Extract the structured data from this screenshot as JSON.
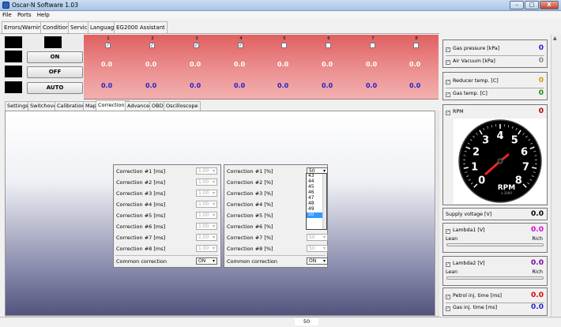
{
  "window": {
    "title": "Oscar-N Software 1.03",
    "minimize": "–",
    "maximize": "□",
    "close": "X"
  },
  "menu": [
    "File",
    "Ports",
    "Help"
  ],
  "top_tabs": [
    "Errors/Warnings",
    "Conditions",
    "Service",
    "Language",
    "EG2000 Assistant"
  ],
  "control_buttons": [
    "ON",
    "OFF",
    "AUTO"
  ],
  "channels": [
    {
      "num": "1",
      "white": "0.0",
      "blue": "0.0",
      "checked": true
    },
    {
      "num": "2",
      "white": "0.0",
      "blue": "0.0",
      "checked": true
    },
    {
      "num": "3",
      "white": "0.0",
      "blue": "0.0",
      "checked": true
    },
    {
      "num": "4",
      "white": "0.0",
      "blue": "0.0",
      "checked": true
    },
    {
      "num": "5",
      "white": "0.0",
      "blue": "0.0",
      "checked": false
    },
    {
      "num": "6",
      "white": "0.0",
      "blue": "0.0",
      "checked": false
    },
    {
      "num": "7",
      "white": "0.0",
      "blue": "0.0",
      "checked": false
    },
    {
      "num": "8",
      "white": "0.0",
      "blue": "0.0",
      "checked": false
    }
  ],
  "sub_tabs": [
    "Settings",
    "Switchover",
    "Calibration",
    "Map",
    "Corrections",
    "Advanced",
    "OBD",
    "Oscilloscope"
  ],
  "active_sub_tab": "Corrections",
  "corrections_ms": {
    "rows": [
      {
        "label": "Correction #1 [ms]",
        "value": "1.00"
      },
      {
        "label": "Correction #2 [ms]",
        "value": "1.00"
      },
      {
        "label": "Correction #3 [ms]",
        "value": "1.00"
      },
      {
        "label": "Correction #4 [ms]",
        "value": "1.00"
      },
      {
        "label": "Correction #5 [ms]",
        "value": "1.00"
      },
      {
        "label": "Correction #6 [ms]",
        "value": "1.00"
      },
      {
        "label": "Correction #7 [ms]",
        "value": "1.00"
      },
      {
        "label": "Correction #8 [ms]",
        "value": "1.00"
      }
    ],
    "common_label": "Common correction",
    "common_value": "ON"
  },
  "corrections_pct": {
    "rows": [
      {
        "label": "Correction #1 [%]",
        "value": "50"
      },
      {
        "label": "Correction #2 [%]",
        "value": "50"
      },
      {
        "label": "Correction #3 [%]",
        "value": "50"
      },
      {
        "label": "Correction #4 [%]",
        "value": "50"
      },
      {
        "label": "Correction #5 [%]",
        "value": "50"
      },
      {
        "label": "Correction #6 [%]",
        "value": "50"
      },
      {
        "label": "Correction #7 [%]",
        "value": "50"
      },
      {
        "label": "Correction #8 [%]",
        "value": "50"
      }
    ],
    "common_label": "Common correction",
    "common_value": "ON",
    "dropdown_options": [
      "43",
      "44",
      "45",
      "46",
      "47",
      "48",
      "49",
      "50"
    ],
    "dropdown_selected": "50"
  },
  "right_panel": {
    "gas_pressure": {
      "label": "Gas pressure [kPa]",
      "value": "0",
      "color": "#1f1fd0"
    },
    "air_vacuum": {
      "label": "Air Vacuum [kPa]",
      "value": "0",
      "color": "#888888"
    },
    "reducer_temp": {
      "label": "Reducer temp. [C]",
      "value": "0",
      "color": "#d49a00"
    },
    "gas_temp": {
      "label": "Gas temp. [C]",
      "value": "0",
      "color": "#1a8a1a"
    },
    "rpm": {
      "label": "RPM",
      "value": "0",
      "color": "#aa0000"
    },
    "gauge": {
      "numbers": [
        "0",
        "1",
        "2",
        "3",
        "4",
        "5",
        "6",
        "7",
        "8"
      ],
      "title": "RPM",
      "subtitle": "x 1000"
    },
    "supply_voltage": {
      "label": "Supply voltage [V]",
      "value": "0.0"
    },
    "lambda1": {
      "label": "Lambda1 [V]",
      "value": "0.0",
      "lean": "Lean",
      "rich": "Rich",
      "color": "#dd00dd"
    },
    "lambda2": {
      "label": "Lambda2 [V]",
      "value": "0.0",
      "lean": "Lean",
      "rich": "Rich",
      "color": "#7a00aa"
    },
    "petrol_inj": {
      "label": "Petrol inj. time [ms]",
      "value": "0.0",
      "color": "#dd0000"
    },
    "gas_inj": {
      "label": "Gas inj. time [ms]",
      "value": "0.0",
      "color": "#1f1fd0"
    }
  },
  "status": {
    "value": "50"
  }
}
